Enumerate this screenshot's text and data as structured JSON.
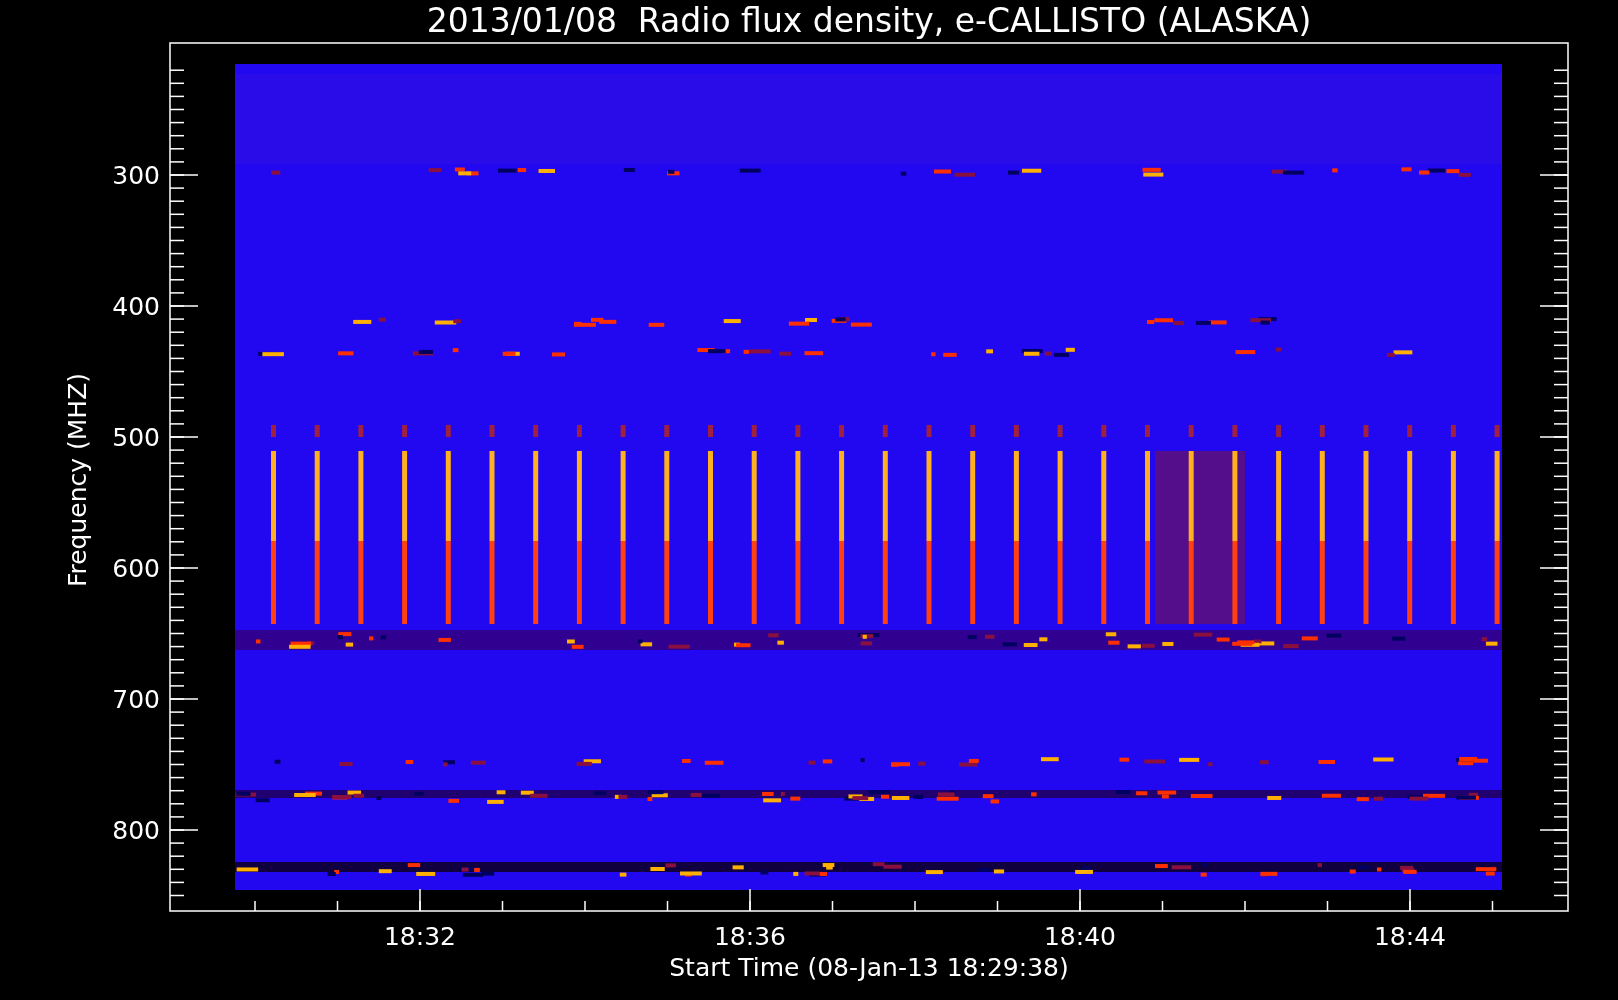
{
  "title": "2013/01/08  Radio flux density, e-CALLISTO (ALASKA)",
  "y_axis": {
    "label": "Frequency (MHZ)",
    "ticks": [
      "300",
      "400",
      "500",
      "600",
      "700",
      "800"
    ]
  },
  "x_axis": {
    "label": "Start Time (08-Jan-13 18:29:38)",
    "ticks": [
      "18:32",
      "18:36",
      "18:40",
      "18:44"
    ]
  }
}
